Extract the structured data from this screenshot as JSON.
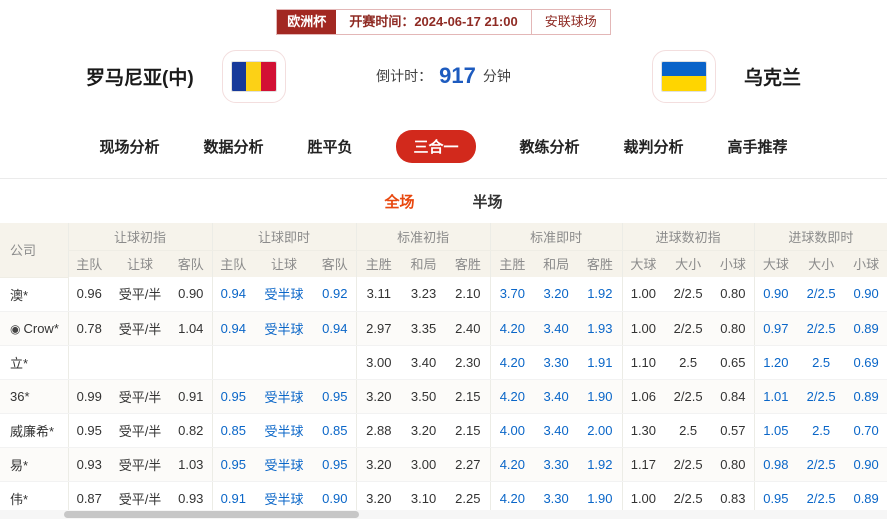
{
  "header": {
    "league": "欧洲杯",
    "match_time_label": "开赛时间：",
    "match_time": "2024-06-17 21:00",
    "venue": "安联球场"
  },
  "teams": {
    "home_name": "罗马尼亚(中)",
    "home_flag_icon": "romania-flag",
    "away_name": "乌克兰",
    "away_flag_icon": "ukraine-flag",
    "countdown_label": "倒计时：",
    "countdown_value": "917",
    "countdown_unit": "分钟"
  },
  "colors": {
    "accent_red": "#d2291c",
    "badge_red": "#a22822",
    "live_blue": "#0a66c8",
    "countdown_blue": "#1d5bbf",
    "active_subtab_orange": "#e8470e",
    "table_header_beige": "#f6f3eb"
  },
  "nav": {
    "tabs": [
      {
        "label": "现场分析",
        "active": false
      },
      {
        "label": "数据分析",
        "active": false
      },
      {
        "label": "胜平负",
        "active": false
      },
      {
        "label": "三合一",
        "active": true
      },
      {
        "label": "教练分析",
        "active": false
      },
      {
        "label": "裁判分析",
        "active": false
      },
      {
        "label": "高手推荐",
        "active": false
      }
    ]
  },
  "subtabs": [
    {
      "label": "全场",
      "active": true
    },
    {
      "label": "半场",
      "active": false
    }
  ],
  "table": {
    "company_header": "公司",
    "groups": [
      {
        "label": "让球初指",
        "cols": [
          "主队",
          "让球",
          "客队"
        ],
        "live": false
      },
      {
        "label": "让球即时",
        "cols": [
          "主队",
          "让球",
          "客队"
        ],
        "live": true
      },
      {
        "label": "标准初指",
        "cols": [
          "主胜",
          "和局",
          "客胜"
        ],
        "live": false
      },
      {
        "label": "标准即时",
        "cols": [
          "主胜",
          "和局",
          "客胜"
        ],
        "live": true
      },
      {
        "label": "进球数初指",
        "cols": [
          "大球",
          "大小",
          "小球"
        ],
        "live": false
      },
      {
        "label": "进球数即时",
        "cols": [
          "大球",
          "大小",
          "小球"
        ],
        "live": true
      }
    ],
    "rows": [
      {
        "company": "澳*",
        "icon": null,
        "cells": [
          "0.96",
          "受平/半",
          "0.90",
          "0.94",
          "受半球",
          "0.92",
          "3.11",
          "3.23",
          "2.10",
          "3.70",
          "3.20",
          "1.92",
          "1.00",
          "2/2.5",
          "0.80",
          "0.90",
          "2/2.5",
          "0.90"
        ]
      },
      {
        "company": "Crow*",
        "icon": "target-icon",
        "cells": [
          "0.78",
          "受平/半",
          "1.04",
          "0.94",
          "受半球",
          "0.94",
          "2.97",
          "3.35",
          "2.40",
          "4.20",
          "3.40",
          "1.93",
          "1.00",
          "2/2.5",
          "0.80",
          "0.97",
          "2/2.5",
          "0.89"
        ]
      },
      {
        "company": "立*",
        "icon": null,
        "cells": [
          "",
          "",
          "",
          "",
          "",
          "",
          "3.00",
          "3.40",
          "2.30",
          "4.20",
          "3.30",
          "1.91",
          "1.10",
          "2.5",
          "0.65",
          "1.20",
          "2.5",
          "0.69"
        ]
      },
      {
        "company": "36*",
        "icon": null,
        "cells": [
          "0.99",
          "受平/半",
          "0.91",
          "0.95",
          "受半球",
          "0.95",
          "3.20",
          "3.50",
          "2.15",
          "4.20",
          "3.40",
          "1.90",
          "1.06",
          "2/2.5",
          "0.84",
          "1.01",
          "2/2.5",
          "0.89"
        ]
      },
      {
        "company": "威廉希*",
        "icon": null,
        "cells": [
          "0.95",
          "受平/半",
          "0.82",
          "0.85",
          "受半球",
          "0.85",
          "2.88",
          "3.20",
          "2.15",
          "4.00",
          "3.40",
          "2.00",
          "1.30",
          "2.5",
          "0.57",
          "1.05",
          "2.5",
          "0.70"
        ]
      },
      {
        "company": "易*",
        "icon": null,
        "cells": [
          "0.93",
          "受平/半",
          "1.03",
          "0.95",
          "受半球",
          "0.95",
          "3.20",
          "3.00",
          "2.27",
          "4.20",
          "3.30",
          "1.92",
          "1.17",
          "2/2.5",
          "0.80",
          "0.98",
          "2/2.5",
          "0.90"
        ]
      },
      {
        "company": "伟*",
        "icon": null,
        "cells": [
          "0.87",
          "受平/半",
          "0.93",
          "0.91",
          "受半球",
          "0.90",
          "3.20",
          "3.10",
          "2.25",
          "4.20",
          "3.30",
          "1.90",
          "1.00",
          "2/2.5",
          "0.83",
          "0.95",
          "2/2.5",
          "0.89"
        ]
      }
    ]
  }
}
